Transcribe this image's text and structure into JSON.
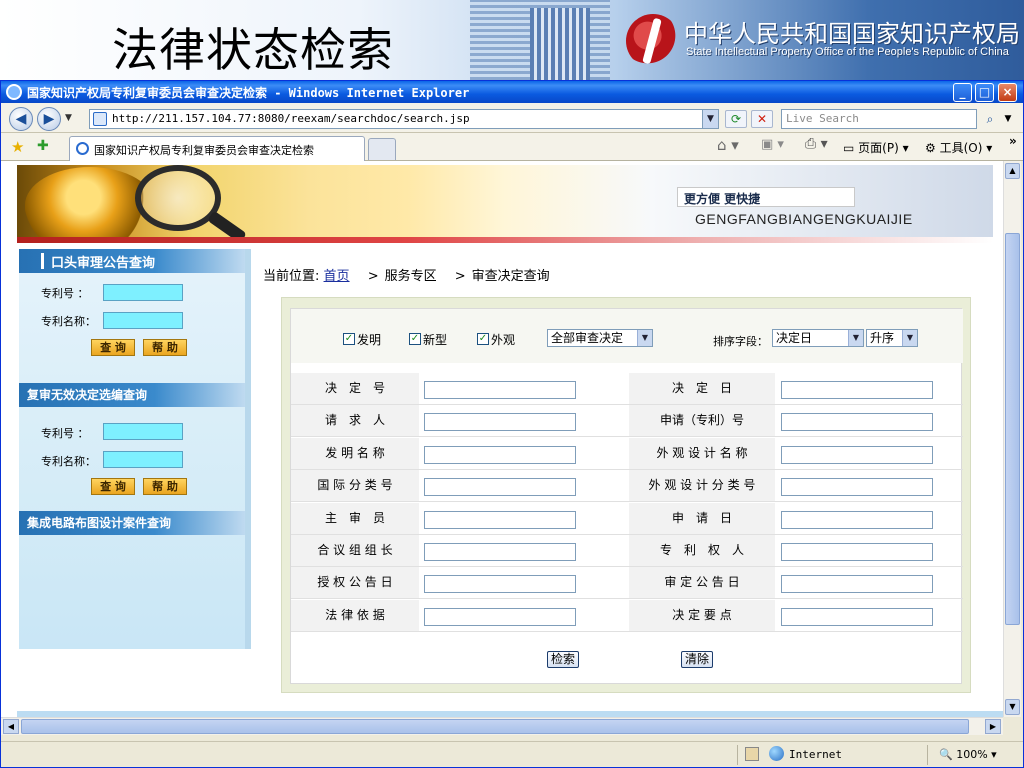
{
  "slide": {
    "title": "法律状态检索",
    "org_cn": "中华人民共和国国家知识产权局",
    "org_en": "State Intellectual Property Office of the People's Republic of China"
  },
  "window": {
    "title": "国家知识产权局专利复审委员会审查决定检索 - Windows Internet Explorer",
    "minimize": "_",
    "maximize": "□",
    "close": "×"
  },
  "address_bar": {
    "url": "http://211.157.104.77:8080/reexam/searchdoc/search.jsp",
    "search_placeholder": "Live Search"
  },
  "tab": {
    "title": "国家知识产权局专利复审委员会审查决定检索"
  },
  "commands": {
    "page": "页面(P)",
    "tools": "工具(O)"
  },
  "banner": {
    "slogan": "更方便 更快捷",
    "pinyin": "GENGFANGBIANGENGKUAIJIE"
  },
  "sidebar": {
    "section1_title": "口头审理公告查询",
    "section2_title": "复审无效决定选编查询",
    "section3_title": "集成电路布图设计案件查询",
    "patent_no_label": "专利号 ：",
    "patent_name_label": "专利名称：",
    "query_btn": "查 询",
    "help_btn": "帮 助"
  },
  "breadcrumb": {
    "prefix": "当前位置:",
    "home": "首页",
    "sep": ">",
    "level1": "服务专区",
    "level2": "审查决定查询"
  },
  "form": {
    "checkboxes": [
      {
        "label": "发明",
        "checked": true
      },
      {
        "label": "新型",
        "checked": true
      },
      {
        "label": "外观",
        "checked": true
      }
    ],
    "decision_type_selected": "全部审查决定",
    "sort_label": "排序字段：",
    "sort_field_selected": "决定日",
    "sort_order_selected": "升序",
    "fields_left": [
      "决　定　号",
      "请　求　人",
      "发 明 名 称",
      "国 际 分 类 号",
      "主　审　员",
      "合 议 组 组 长",
      "授 权 公 告 日",
      "法 律 依 据"
    ],
    "fields_right": [
      "决　定　日",
      "申请（专利）号",
      "外 观 设 计 名 称",
      "外 观 设 计 分 类 号",
      "申　请　日",
      "专　利　权　人",
      "审 定 公 告 日",
      "决 定 要 点"
    ],
    "search_btn": "检索",
    "clear_btn": "清除"
  },
  "status": {
    "zone": "Internet",
    "zoom": "100%"
  }
}
